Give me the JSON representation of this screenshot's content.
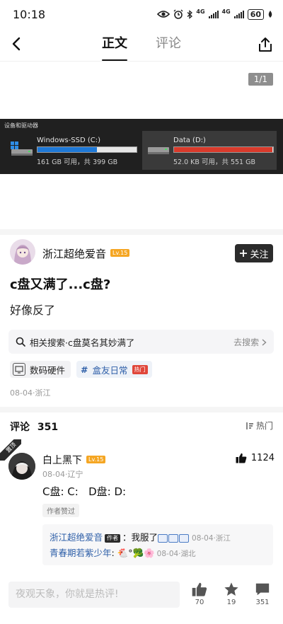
{
  "status_bar": {
    "time": "10:18",
    "network_1": "4G",
    "network_2": "4G",
    "battery": "60"
  },
  "nav": {
    "tabs": [
      {
        "label": "正文",
        "active": true
      },
      {
        "label": "评论",
        "active": false
      }
    ]
  },
  "image": {
    "page_indicator": "1/1",
    "section_title": "设备和驱动器",
    "drives": [
      {
        "name": "Windows-SSD (C:)",
        "info": "161 GB 可用，共 399 GB",
        "fill_fraction": 0.6,
        "fill_color": "#1e78d6"
      },
      {
        "name": "Data (D:)",
        "info": "52.0 KB 可用，共 551 GB",
        "fill_fraction": 0.99,
        "fill_color": "#d93a2b"
      }
    ]
  },
  "post": {
    "author_name": "浙江超绝爱音",
    "author_level": "Lv.15",
    "follow_label": "关注",
    "title": "c盘又满了...c盘?",
    "body": "好像反了",
    "related_search": "相关搜索·c盘莫名其妙满了",
    "related_action": "去搜索",
    "tags": [
      {
        "label": "数码硬件"
      },
      {
        "label": "盒友日常",
        "badge": "热门"
      }
    ],
    "meta": "08-04·浙江"
  },
  "comments": {
    "header_label": "评论",
    "count": "351",
    "sort_label": "热门",
    "pinned_label": "置顶",
    "top_comment": {
      "author": "白上黑下",
      "level": "Lv.15",
      "likes": "1124",
      "meta": "08-04·辽宁",
      "text": "C盘: C:   D盘: D:",
      "badge": "作者赞过"
    },
    "replies": [
      {
        "author": "浙江超绝爱音",
        "author_tag": "作者",
        "text": "：我服了",
        "emoji_count": 3,
        "date": "08-04·浙江"
      },
      {
        "author": "青春期若紫少年",
        "text": ":",
        "emojis": "🐔°🥦🌸",
        "date": "08-04·湖北"
      }
    ]
  },
  "bottom_bar": {
    "input_placeholder": "夜观天象，你就是热评!",
    "like_count": "70",
    "favorite_count": "19",
    "comment_count": "351"
  }
}
